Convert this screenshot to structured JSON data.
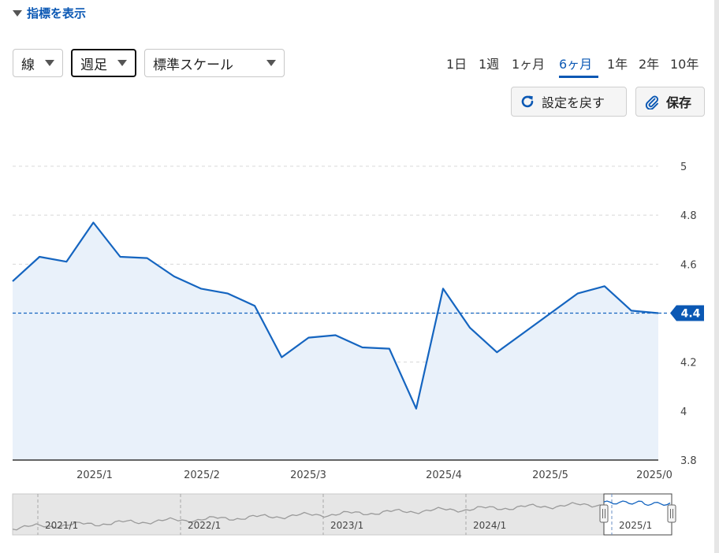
{
  "header": {
    "indicator_toggle_label": "指標を表示"
  },
  "controls": {
    "chart_type": "線",
    "interval": "週足",
    "scale": "標準スケール"
  },
  "ranges": [
    {
      "label": "1日"
    },
    {
      "label": "1週"
    },
    {
      "label": "1ヶ月"
    },
    {
      "label": "6ヶ月",
      "selected": true
    },
    {
      "label": "1年"
    },
    {
      "label": "2年"
    },
    {
      "label": "10年"
    }
  ],
  "buttons": {
    "reset_label": "設定を戻す",
    "save_label": "保存"
  },
  "colors": {
    "accent": "#0b58b4",
    "line": "#1565c0",
    "area": "#e9f1fa",
    "grid": "#d8d8d8"
  },
  "chart_data": {
    "type": "area",
    "current_value_label": "4.4",
    "ylim": [
      3.8,
      5.0
    ],
    "y_ticks": [
      5,
      4.8,
      4.6,
      4.4,
      4.2,
      4,
      3.8
    ],
    "y_tick_labels": [
      "5",
      "4.8",
      "4.6",
      "",
      "4.2",
      "4",
      "3.8"
    ],
    "x_tick_labels": [
      "2025/1",
      "2025/2",
      "2025/3",
      "2025/4",
      "2025/5",
      "2025/0"
    ],
    "series": [
      {
        "values": [
          4.53,
          4.63,
          4.61,
          4.77,
          4.63,
          4.625,
          4.55,
          4.5,
          4.48,
          4.43,
          4.22,
          4.3,
          4.31,
          4.26,
          4.255,
          4.01,
          4.5,
          4.34,
          4.24,
          4.32,
          4.4,
          4.48,
          4.51,
          4.41,
          4.4
        ]
      }
    ],
    "current_value": 4.4,
    "navigator": {
      "year_labels": [
        "2021/1",
        "2022/1",
        "2023/1",
        "2024/1",
        "2025/1"
      ]
    }
  }
}
